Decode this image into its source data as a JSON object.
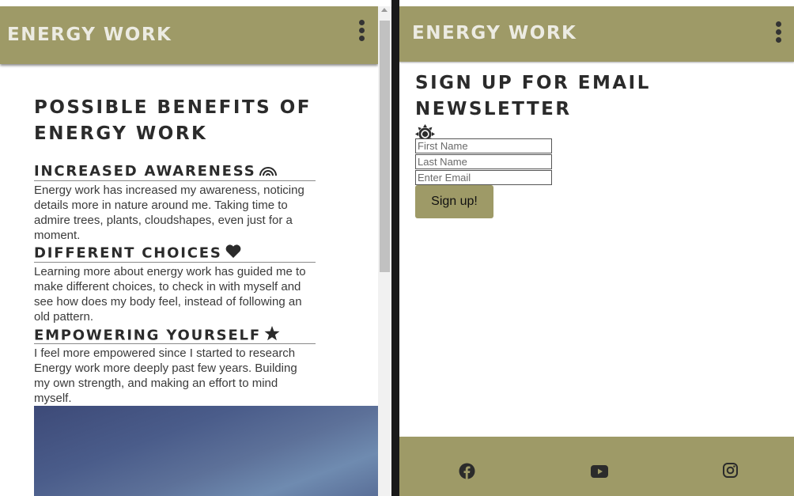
{
  "left": {
    "brand": "ENERGY WORK",
    "section_title": "POSSIBLE BENEFITS OF ENERGY WORK",
    "benefits": [
      {
        "title": "INCREASED AWARENESS",
        "icon": "rainbow-icon",
        "text": "Energy work has increased my awareness, noticing details more in nature around me. Taking time to admire trees, plants, cloudshapes, even just for a moment."
      },
      {
        "title": "DIFFERENT CHOICES",
        "icon": "heart-icon",
        "text": "Learning more about energy work has guided me to make different choices, to check in with myself and see how does my body feel, instead of following an old pattern."
      },
      {
        "title": "EMPOWERING YOURSELF",
        "icon": "star-icon",
        "text": "I feel more empowered since I started to research Energy work more deeply past few years. Building my own strength, and making an effort to mind myself."
      }
    ]
  },
  "right": {
    "brand": "ENERGY WORK",
    "signup_title": "SIGN UP FOR EMAIL NEWSLETTER",
    "signup_icon": "sun-icon",
    "form": {
      "first_name_placeholder": "First Name",
      "last_name_placeholder": "Last Name",
      "email_placeholder": "Enter Email",
      "submit_label": "Sign up!"
    },
    "social": [
      "facebook-icon",
      "youtube-icon",
      "instagram-icon"
    ]
  },
  "colors": {
    "brand_olive": "#9e9a67",
    "brand_text": "#ecebe2",
    "heading_text": "#2b2b2b",
    "divider": "#1a1a1a"
  }
}
